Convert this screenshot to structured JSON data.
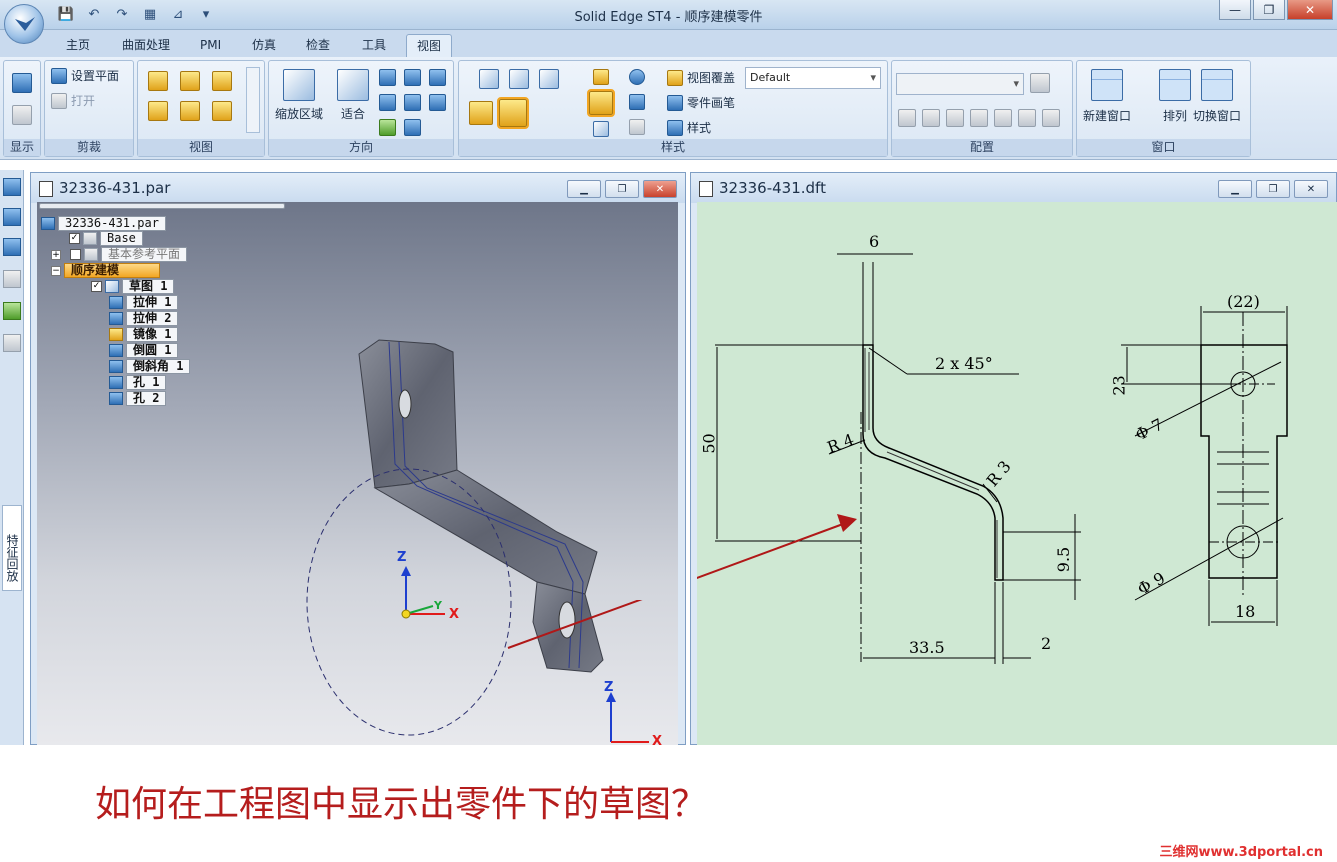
{
  "title_bar": {
    "title": "Solid Edge ST4 - 顺序建模零件"
  },
  "tabs": [
    {
      "label": "主页"
    },
    {
      "label": "曲面处理"
    },
    {
      "label": "PMI"
    },
    {
      "label": "仿真"
    },
    {
      "label": "检查"
    },
    {
      "label": "工具"
    },
    {
      "label": "视图"
    }
  ],
  "ribbon": {
    "groups": {
      "show": "显示",
      "clip": "剪裁",
      "views": "视图",
      "orient": "方向",
      "style": "样式",
      "config": "配置",
      "window": "窗口"
    },
    "clip": {
      "set_plane": "设置平面",
      "open": "打开"
    },
    "orient": {
      "zoom_area": "缩放区域",
      "fit": "适合"
    },
    "style": {
      "view_override": "视图覆盖",
      "override_value": "Default",
      "part_painter": "零件画笔",
      "styles": "样式"
    },
    "window": {
      "new_window": "新建窗口",
      "arrange": "排列",
      "switch_window": "切换窗口"
    }
  },
  "left_bar": {
    "feature_playback": "特征回放"
  },
  "part_window": {
    "title": "32336-431.par",
    "tree": {
      "root": "32336-431.par",
      "base": "Base",
      "ref_planes": "基本参考平面",
      "ordered": "顺序建模",
      "features": [
        "草图 1",
        "拉伸 1",
        "拉伸 2",
        "镜像 1",
        "倒圆 1",
        "倒斜角 1",
        "孔 1",
        "孔 2"
      ]
    },
    "axes": {
      "x": "X",
      "y": "Y",
      "z": "Z"
    }
  },
  "draft_window": {
    "title": "32336-431.dft",
    "dims": {
      "top_width": "6",
      "chamfer": "2 x 45°",
      "height": "50",
      "r_left": "R 4",
      "r_right": "R 3",
      "foot": "9.5",
      "run": "33.5",
      "thick": "2",
      "width_ref": "(22)",
      "hole_pos": "23",
      "hole1": "Φ 7",
      "hole2": "Φ 9",
      "bottom_width": "18"
    }
  },
  "caption": "如何在工程图中显示出零件下的草图？",
  "watermark": "三维网www.3dportal.cn",
  "colors": {
    "arrow": "#b01818",
    "caption": "#b51d1d",
    "sheet": "#cfe8d3"
  }
}
